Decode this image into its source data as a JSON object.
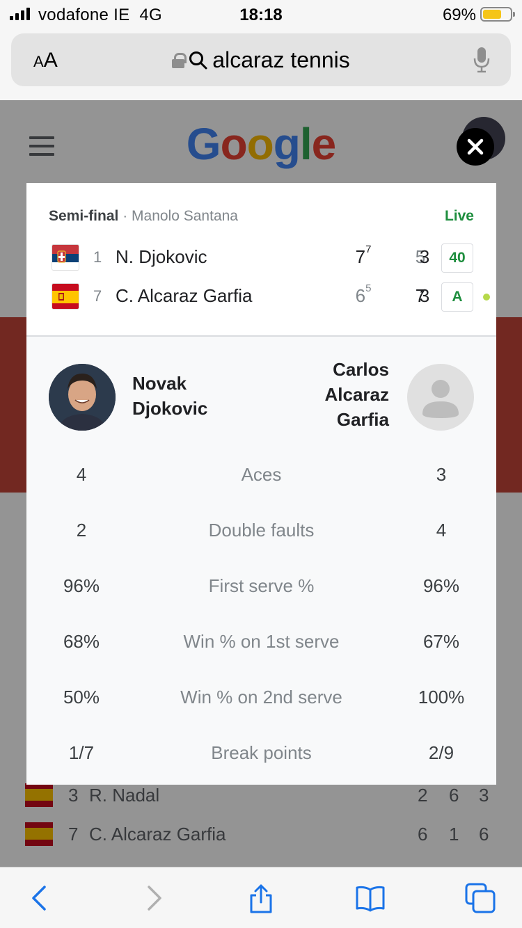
{
  "status_bar": {
    "carrier": "vodafone IE",
    "network": "4G",
    "time": "18:18",
    "battery_percent": "69%",
    "battery_level": 0.69
  },
  "url_bar": {
    "text_size_label": "AA",
    "query": "alcaraz tennis"
  },
  "background_page": {
    "logo": "Google",
    "rows": [
      {
        "seed": "3",
        "name": "R. Nadal",
        "sets": [
          "2",
          "6",
          "3"
        ]
      },
      {
        "seed": "7",
        "name": "C. Alcaraz Garfia",
        "sets": [
          "6",
          "1",
          "6"
        ]
      }
    ]
  },
  "match": {
    "round": "Semi-final",
    "venue": "Manolo Santana",
    "status": "Live",
    "players": [
      {
        "seed": "1",
        "name": "N. Djokovic",
        "country": "Serbia",
        "sets": [
          {
            "score": "7",
            "tiebreak": "7",
            "won": true
          },
          {
            "score": "5",
            "tiebreak": "",
            "won": false
          },
          {
            "score": "3",
            "tiebreak": "",
            "won": true
          }
        ],
        "game": "40",
        "serving": false
      },
      {
        "seed": "7",
        "name": "C. Alcaraz Garfia",
        "country": "Spain",
        "sets": [
          {
            "score": "6",
            "tiebreak": "5",
            "won": false
          },
          {
            "score": "7",
            "tiebreak": "",
            "won": true
          },
          {
            "score": "3",
            "tiebreak": "",
            "won": true
          }
        ],
        "game": "A",
        "serving": true
      }
    ]
  },
  "stats": {
    "player1_name": "Novak Djokovic",
    "player2_name": "Carlos Alcaraz Garfia",
    "rows": [
      {
        "label": "Aces",
        "p1": "4",
        "p2": "3"
      },
      {
        "label": "Double faults",
        "p1": "2",
        "p2": "4"
      },
      {
        "label": "First serve %",
        "p1": "96%",
        "p2": "96%"
      },
      {
        "label": "Win % on 1st serve",
        "p1": "68%",
        "p2": "67%"
      },
      {
        "label": "Win % on 2nd serve",
        "p1": "50%",
        "p2": "100%"
      },
      {
        "label": "Break points",
        "p1": "1/7",
        "p2": "2/9"
      }
    ]
  },
  "colors": {
    "live_green": "#1e8e3e",
    "serve_dot": "#b6d94a",
    "ios_blue": "#1a73e8"
  }
}
